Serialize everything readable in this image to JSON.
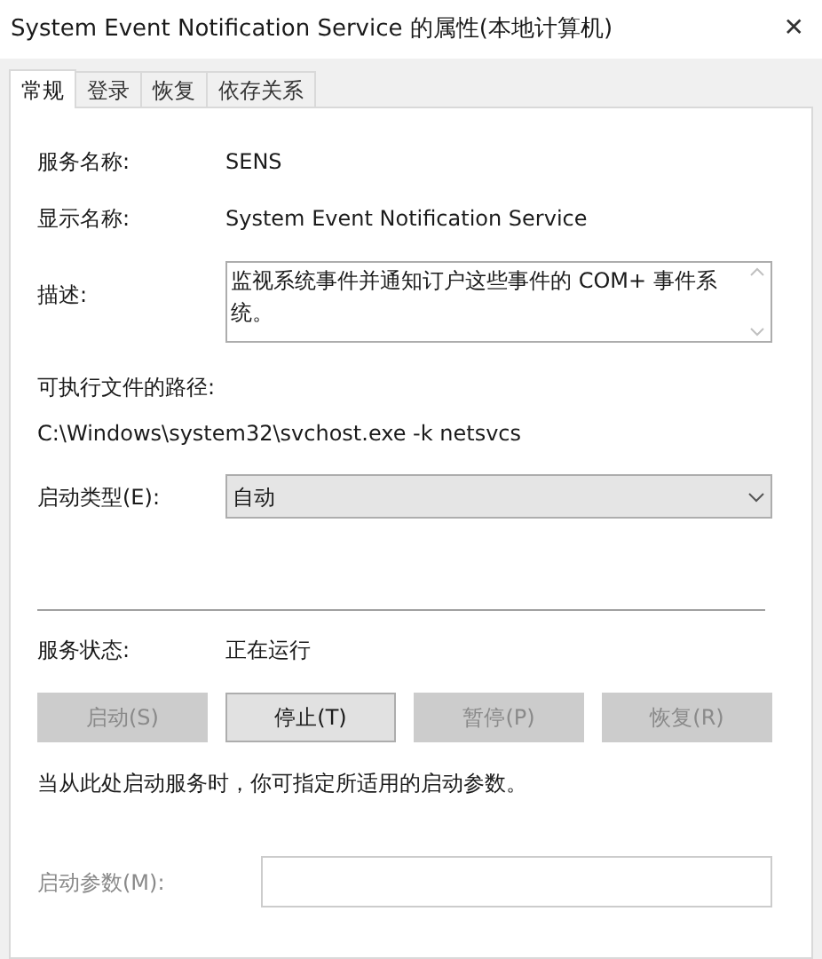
{
  "window": {
    "title": "System Event Notification Service 的属性(本地计算机)",
    "close": "✕"
  },
  "tabs": [
    {
      "label": "常规",
      "selected": true
    },
    {
      "label": "登录",
      "selected": false
    },
    {
      "label": "恢复",
      "selected": false
    },
    {
      "label": "依存关系",
      "selected": false
    }
  ],
  "service_name": {
    "label": "服务名称:",
    "value": "SENS"
  },
  "display_name": {
    "label": "显示名称:",
    "value": "System Event Notification Service"
  },
  "description": {
    "label": "描述:",
    "value": "监视系统事件并通知订户这些事件的 COM+ 事件系统。"
  },
  "executable_path": {
    "label": "可执行文件的路径:",
    "value": "C:\\Windows\\system32\\svchost.exe -k netsvcs"
  },
  "startup_type": {
    "label": "启动类型(E):",
    "value": "自动"
  },
  "service_status": {
    "label": "服务状态:",
    "value": "正在运行"
  },
  "buttons": [
    {
      "label": "启动(S)",
      "disabled": true
    },
    {
      "label": "停止(T)",
      "disabled": false
    },
    {
      "label": "暂停(P)",
      "disabled": true
    },
    {
      "label": "恢复(R)",
      "disabled": true
    }
  ],
  "hint": "当从此处启动服务时，你可指定所适用的启动参数。",
  "start_parameters": {
    "label": "启动参数(M):",
    "disabled": true
  }
}
